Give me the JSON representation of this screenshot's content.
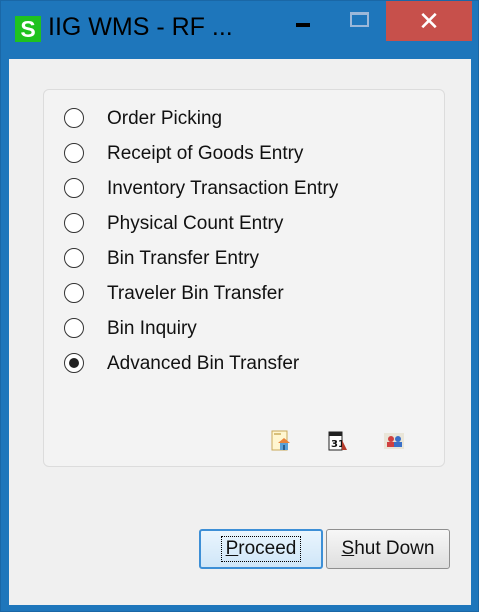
{
  "window": {
    "app_icon_letter": "S",
    "title": "IIG WMS - RF ...",
    "close_glyph": "✕"
  },
  "options": [
    {
      "label": "Order Picking",
      "checked": false
    },
    {
      "label": "Receipt of Goods Entry",
      "checked": false
    },
    {
      "label": "Inventory Transaction Entry",
      "checked": false
    },
    {
      "label": "Physical Count Entry",
      "checked": false
    },
    {
      "label": "Bin Transfer Entry",
      "checked": false
    },
    {
      "label": "Traveler Bin Transfer",
      "checked": false
    },
    {
      "label": "Bin Inquiry",
      "checked": false
    },
    {
      "label": "Advanced Bin Transfer",
      "checked": true
    }
  ],
  "toolbar_icons": [
    "home-document-icon",
    "calendar-icon",
    "users-icon"
  ],
  "buttons": {
    "proceed_first": "P",
    "proceed_rest": "roceed",
    "shutdown_first": "S",
    "shutdown_rest": "hut Down"
  },
  "colors": {
    "title_bar": "#1e76bb",
    "app_icon": "#1fc21f",
    "close_button": "#c7504b",
    "client_bg": "#f0f0f0"
  }
}
